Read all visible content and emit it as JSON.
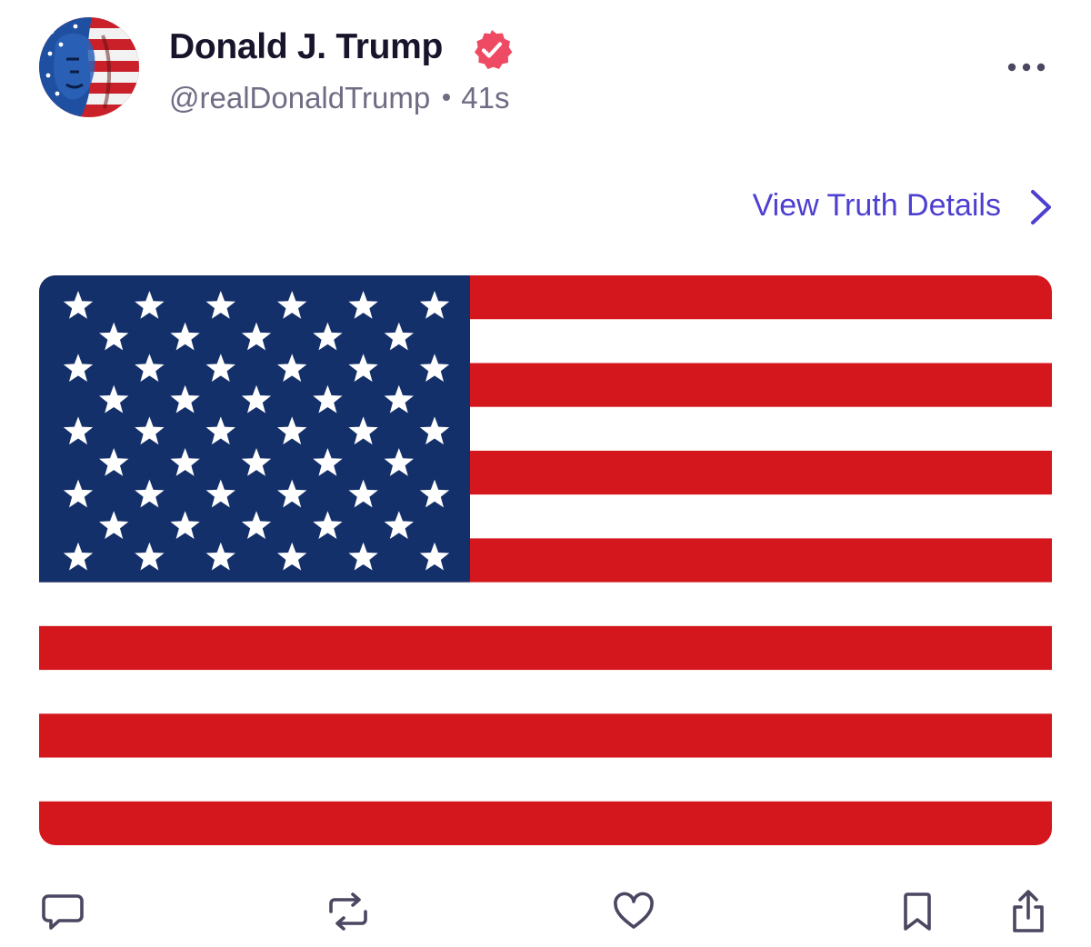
{
  "post": {
    "author": {
      "display_name": "Donald J. Trump",
      "handle": "@realDonaldTrump",
      "verified": true,
      "verified_color": "#ef4a63"
    },
    "timestamp": "41s",
    "details_link": "View Truth Details",
    "media": {
      "type": "image",
      "subject": "United States flag",
      "colors": {
        "canton": "#14306a",
        "red_stripe": "#d4161d",
        "white_stripe": "#ffffff",
        "star": "#ffffff"
      }
    },
    "actions": [
      {
        "name": "reply",
        "icon": "speech-bubble-icon"
      },
      {
        "name": "retruth",
        "icon": "repost-arrows-icon"
      },
      {
        "name": "like",
        "icon": "heart-icon"
      },
      {
        "name": "bookmark",
        "icon": "bookmark-icon"
      },
      {
        "name": "share",
        "icon": "share-icon"
      }
    ]
  },
  "theme": {
    "link_color": "#4d3fd0",
    "secondary_text": "#6f6c84",
    "icon_color": "#4a4760"
  }
}
